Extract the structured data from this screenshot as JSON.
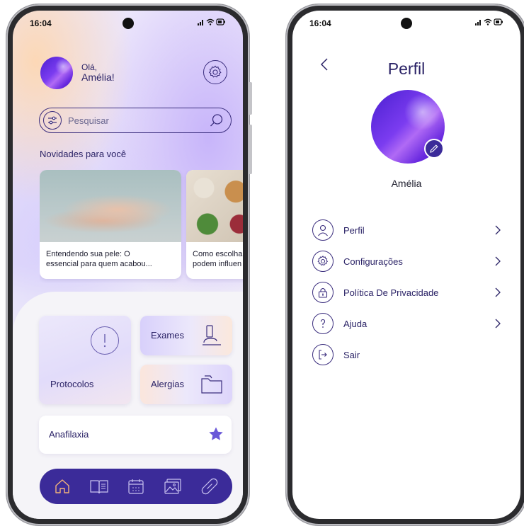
{
  "home": {
    "status": {
      "time": "16:04",
      "signal_icons": "📶"
    },
    "greeting": {
      "hello": "Olá,",
      "name": "Amélia!"
    },
    "search": {
      "placeholder": "Pesquisar"
    },
    "section_title": "Novidades para você",
    "news": [
      {
        "line1": "Entendendo sua pele: O",
        "line2": "essencial para quem acabou..."
      },
      {
        "line1": "Como escolha",
        "line2": "podem influen"
      }
    ],
    "tiles": {
      "protocolos": "Protocolos",
      "exames": "Exames",
      "alergias": "Alergias"
    },
    "favorite": {
      "label": "Anafilaxia"
    },
    "nav": [
      {
        "icon": "home-icon",
        "active": true
      },
      {
        "icon": "book-icon",
        "active": false
      },
      {
        "icon": "calendar-icon",
        "active": false
      },
      {
        "icon": "gallery-icon",
        "active": false
      },
      {
        "icon": "pill-icon",
        "active": false
      }
    ],
    "colors": {
      "accent": "#3b2b99",
      "active_nav": "#f2b27a",
      "star": "#6a58d8"
    }
  },
  "profile": {
    "status": {
      "time": "16:04"
    },
    "title": "Perfil",
    "name": "Amélia",
    "menu": [
      {
        "label": "Perfil",
        "icon": "user-icon",
        "chevron": true
      },
      {
        "label": "Configurações",
        "icon": "gear-icon",
        "chevron": true
      },
      {
        "label": "Política De Privacidade",
        "icon": "lock-icon",
        "chevron": true
      },
      {
        "label": "Ajuda",
        "icon": "question-icon",
        "chevron": true
      },
      {
        "label": "Sair",
        "icon": "logout-icon",
        "chevron": false
      }
    ]
  }
}
